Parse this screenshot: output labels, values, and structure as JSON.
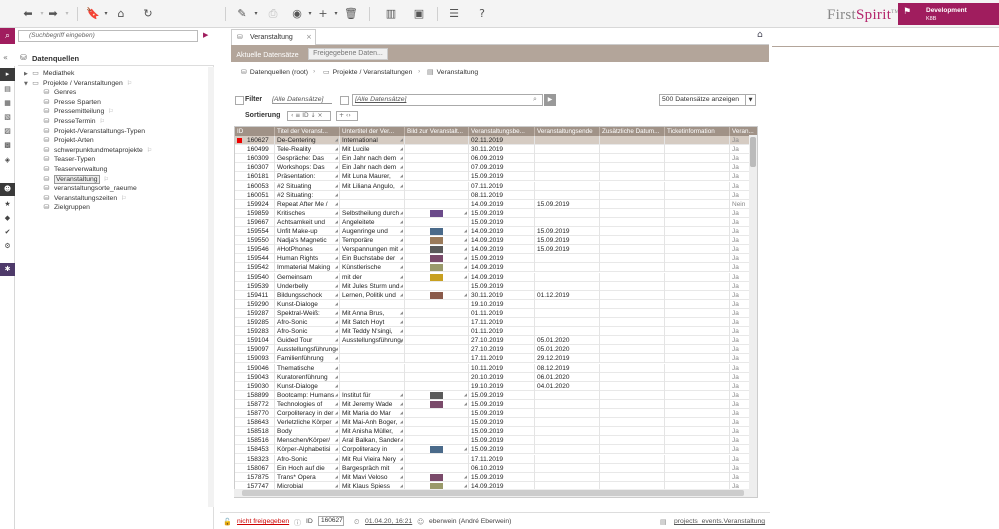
{
  "app": {
    "logo_first": "First",
    "logo_spirit": "Spirit",
    "logo_tm": "TM",
    "project_name": "Development",
    "project_sub": "K8B"
  },
  "toolbar": {
    "icons": [
      "back-icon",
      "forward-icon",
      "bookmark-icon",
      "home-icon",
      "refresh-icon",
      "edit-icon",
      "release-icon",
      "preview-icon",
      "add-icon",
      "delete-icon",
      "stats-icon",
      "photo-icon",
      "list-icon",
      "help-icon"
    ]
  },
  "search": {
    "placeholder": "(Suchbegriff eingeben)"
  },
  "tree": {
    "header": "Datenquellen",
    "items": [
      {
        "label": "Mediathek",
        "level": 0,
        "expand": "▶"
      },
      {
        "label": "Projekte / Veranstaltungen",
        "level": 0,
        "expand": "▼",
        "pin": true
      },
      {
        "label": "Genres",
        "level": 1
      },
      {
        "label": "Presse Sparten",
        "level": 1
      },
      {
        "label": "Pressemitteilung",
        "level": 1,
        "pin": true
      },
      {
        "label": "PresseTermin",
        "level": 1,
        "pin": true
      },
      {
        "label": "Projekt-/Veranstaltungs-Typen",
        "level": 1
      },
      {
        "label": "Projekt-Arten",
        "level": 1
      },
      {
        "label": "schwerpunktundmetaprojekte",
        "level": 1,
        "pin": true
      },
      {
        "label": "Teaser-Typen",
        "level": 1
      },
      {
        "label": "Teaserverwaltung",
        "level": 1
      },
      {
        "label": "Veranstaltung",
        "level": 1,
        "pin": true,
        "selected": true
      },
      {
        "label": "veranstaltungsorte_raeume",
        "level": 1
      },
      {
        "label": "Veranstaltungszeiten",
        "level": 1,
        "pin": true
      },
      {
        "label": "Zielgruppen",
        "level": 1
      }
    ]
  },
  "tab": {
    "label": "Veranstaltung",
    "close": "×"
  },
  "subtabs": {
    "active": "Aktuelle Datensätze",
    "inactive": "Freigegebene Daten..."
  },
  "breadcrumb": [
    "Datenquellen (root)",
    "Projekte / Veranstaltungen",
    "Veranstaltung"
  ],
  "filter": {
    "label": "Filter",
    "all1": "[Alle Datensätze]",
    "all2": "[Alle Datensätze]",
    "page_size": "500 Datensätze anzeigen"
  },
  "sort": {
    "label": "Sortierung",
    "field": "ID"
  },
  "grid": {
    "columns": [
      "ID",
      "Titel der Veranst...",
      "Untertitel der Ver...",
      "Bild zur Veranstalt...",
      "Veranstaltungsbe...",
      "Veranstaltungsende",
      "Zusätzliche Datum...",
      "Ticketinformation",
      "Veran..."
    ],
    "rows": [
      [
        "160627",
        "De-Centering",
        "International",
        "",
        "02.11.2019",
        "",
        "",
        "",
        "Ja"
      ],
      [
        "160499",
        "Tele-Reality",
        "Mit Lucile",
        "",
        "30.11.2019",
        "",
        "",
        "",
        "Ja"
      ],
      [
        "160309",
        "Gespräche: Das",
        "Ein Jahr nach dem",
        "",
        "06.09.2019",
        "",
        "",
        "",
        "Ja"
      ],
      [
        "160307",
        "Workshops: Das",
        "Ein Jahr nach dem",
        "",
        "07.09.2019",
        "",
        "",
        "",
        "Ja"
      ],
      [
        "160181",
        "Präsentation:",
        "Mit Luna Maurer,",
        "",
        "15.09.2019",
        "",
        "",
        "",
        "Ja"
      ],
      [
        "160053",
        "#2 Situating",
        "Mit Liliana Angulo,",
        "",
        "07.11.2019",
        "",
        "",
        "",
        "Ja"
      ],
      [
        "160051",
        "#2 Situating:",
        "",
        "",
        "08.11.2019",
        "",
        "",
        "",
        "Ja"
      ],
      [
        "159924",
        "Repeat After Me /",
        "",
        "",
        "14.09.2019",
        "15.09.2019",
        "",
        "",
        "Nein"
      ],
      [
        "159859",
        "Kritisches",
        "Selbstheilung durch",
        "img",
        "15.09.2019",
        "",
        "",
        "",
        "Ja"
      ],
      [
        "159667",
        "Achtsamkeit und",
        "Angeleitete",
        "",
        "15.09.2019",
        "",
        "",
        "",
        "Ja"
      ],
      [
        "159554",
        "Unfit Make-up",
        "Augenringe und",
        "img",
        "14.09.2019",
        "15.09.2019",
        "",
        "",
        "Ja"
      ],
      [
        "159550",
        "Nadja's Magnetic",
        "Temporäre",
        "img",
        "14.09.2019",
        "15.09.2019",
        "",
        "",
        "Ja"
      ],
      [
        "159546",
        "#HotPhones",
        "Verspannungen mit",
        "img",
        "14.09.2019",
        "15.09.2019",
        "",
        "",
        "Ja"
      ],
      [
        "159544",
        "Human Rights",
        "Ein Buchstabe der",
        "img",
        "15.09.2019",
        "",
        "",
        "",
        "Ja"
      ],
      [
        "159542",
        "Immaterial Making",
        "Künstlerische",
        "img",
        "14.09.2019",
        "",
        "",
        "",
        "Ja"
      ],
      [
        "159540",
        "Gemeinsam",
        "mit der",
        "img",
        "14.09.2019",
        "",
        "",
        "",
        "Ja"
      ],
      [
        "159539",
        "Underbelly",
        "Mit Jules Sturm und",
        "",
        "15.09.2019",
        "",
        "",
        "",
        "Ja"
      ],
      [
        "159411",
        "Bildungsschock",
        "Lernen, Politik und",
        "img",
        "30.11.2019",
        "01.12.2019",
        "",
        "",
        "Ja"
      ],
      [
        "159290",
        "Kunst-Dialoge",
        "",
        "",
        "19.10.2019",
        "",
        "",
        "",
        "Ja"
      ],
      [
        "159287",
        "Spektral-Weiß:",
        "Mit Anna Brus,",
        "",
        "01.11.2019",
        "",
        "",
        "",
        "Ja"
      ],
      [
        "159285",
        "Afro-Sonic",
        "Mit Satch Hoyt",
        "",
        "17.11.2019",
        "",
        "",
        "",
        "Ja"
      ],
      [
        "159283",
        "Afro-Sonic",
        "Mit Teddy N'singi,",
        "",
        "01.11.2019",
        "",
        "",
        "",
        "Ja"
      ],
      [
        "159104",
        "Guided Tour",
        "Ausstellungsführung,",
        "",
        "27.10.2019",
        "05.01.2020",
        "",
        "",
        "Ja"
      ],
      [
        "159097",
        "Ausstellungsführung",
        "",
        "",
        "27.10.2019",
        "05.01.2020",
        "",
        "",
        "Ja"
      ],
      [
        "159093",
        "Familienführung",
        "",
        "",
        "17.11.2019",
        "29.12.2019",
        "",
        "",
        "Ja"
      ],
      [
        "159046",
        "Thematische",
        "",
        "",
        "10.11.2019",
        "08.12.2019",
        "",
        "",
        "Ja"
      ],
      [
        "159043",
        "Kuratorenführung",
        "",
        "",
        "20.10.2019",
        "06.01.2020",
        "",
        "",
        "Ja"
      ],
      [
        "159030",
        "Kunst-Dialoge",
        "",
        "",
        "19.10.2019",
        "04.01.2020",
        "",
        "",
        "Ja"
      ],
      [
        "158899",
        "Bootcamp: Humans",
        "Institut für",
        "img",
        "15.09.2019",
        "",
        "",
        "",
        "Ja"
      ],
      [
        "158772",
        "Technologies of",
        "Mit Jeremy Wade",
        "img",
        "15.09.2019",
        "",
        "",
        "",
        "Ja"
      ],
      [
        "158770",
        "Corpoliteracy in der",
        "Mit Maria do Mar",
        "",
        "15.09.2019",
        "",
        "",
        "",
        "Ja"
      ],
      [
        "158643",
        "Verletzliche Körper",
        "Mit Mai-Anh Boger,",
        "",
        "15.09.2019",
        "",
        "",
        "",
        "Ja"
      ],
      [
        "158518",
        "Body",
        "Mit Anisha Müller,",
        "",
        "15.09.2019",
        "",
        "",
        "",
        "Ja"
      ],
      [
        "158516",
        "Menschen/Körper/",
        "Aral Balkan, Sander",
        "",
        "15.09.2019",
        "",
        "",
        "",
        "Ja"
      ],
      [
        "158453",
        "Körper-Alphabetisi",
        "Corpoliteracy in",
        "img",
        "15.09.2019",
        "",
        "",
        "",
        "Ja"
      ],
      [
        "158323",
        "Afro-Sonic",
        "Mit Rui Vieira Nery",
        "",
        "17.11.2019",
        "",
        "",
        "",
        "Ja"
      ],
      [
        "158067",
        "Ein Hoch auf die",
        "Bargespräch mit",
        "",
        "06.10.2019",
        "",
        "",
        "",
        "Ja"
      ],
      [
        "157875",
        "Trans* Opera",
        "Mit Mavi Veloso",
        "img",
        "15.09.2019",
        "",
        "",
        "",
        "Ja"
      ],
      [
        "157747",
        "Microbial",
        "Mit Klaus Spiess",
        "img",
        "14.09.2019",
        "",
        "",
        "",
        "Ja"
      ]
    ]
  },
  "footer": {
    "status": "nicht freigegeben",
    "id_label": "ID",
    "id_value": "160627",
    "date": "01.04.20, 16:21",
    "user": "eberwein (André Eberwein)",
    "table": "projects_events.Veranstaltung"
  },
  "colors": {
    "brand": "#a01d5e",
    "header": "#a09287",
    "subtab": "#b3a59a"
  }
}
